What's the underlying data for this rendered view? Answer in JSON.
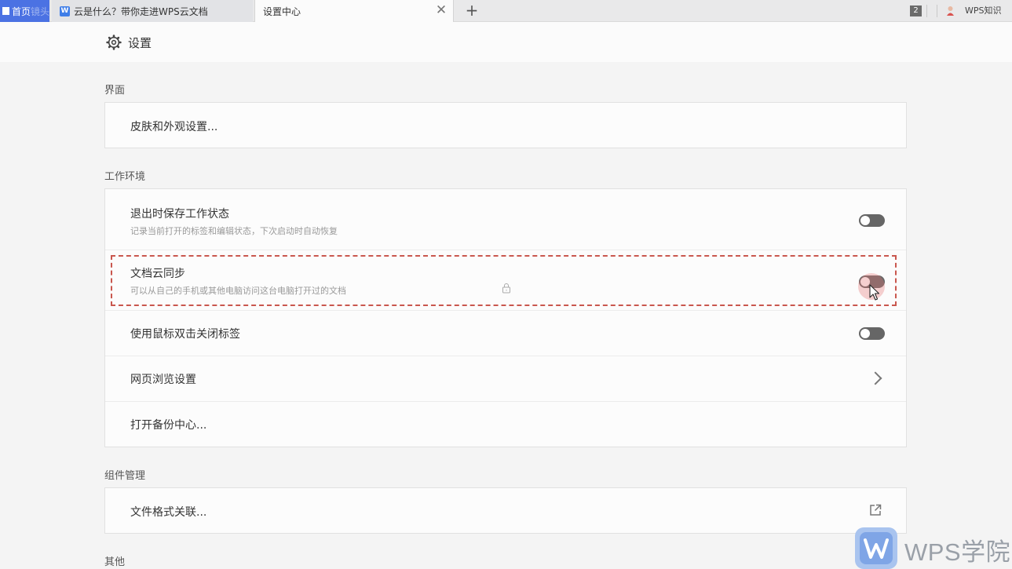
{
  "tabs": {
    "home": {
      "label_main": "首页",
      "label_dim": "镜头"
    },
    "doc": {
      "label": "云是什么？带你走进WPS云文档",
      "icon": "W"
    },
    "active": {
      "label": "设置中心",
      "close": "✕"
    },
    "add": "+",
    "window_count": "2",
    "user_name": "WPS知识"
  },
  "header": {
    "title": "设置"
  },
  "sections": {
    "interface": {
      "title": "界面",
      "items": [
        {
          "label": "皮肤和外观设置..."
        }
      ]
    },
    "workspace": {
      "title": "工作环境",
      "items": [
        {
          "label": "退出时保存工作状态",
          "desc": "记录当前打开的标签和编辑状态，下次启动时自动恢复",
          "toggle": "off"
        },
        {
          "label": "文档云同步",
          "desc": "可以从自己的手机或其他电脑访问这台电脑打开过的文档",
          "toggle": "off"
        },
        {
          "label": "使用鼠标双击关闭标签",
          "toggle": "off"
        },
        {
          "label": "网页浏览设置"
        },
        {
          "label": "打开备份中心..."
        }
      ]
    },
    "components": {
      "title": "组件管理",
      "items": [
        {
          "label": "文件格式关联..."
        }
      ]
    },
    "other": {
      "title": "其他"
    }
  },
  "watermark": {
    "text": "WPS学院"
  },
  "colors": {
    "accent": "#4b72e3",
    "highlight": "#c9574e",
    "toggle_off": "#666666"
  }
}
